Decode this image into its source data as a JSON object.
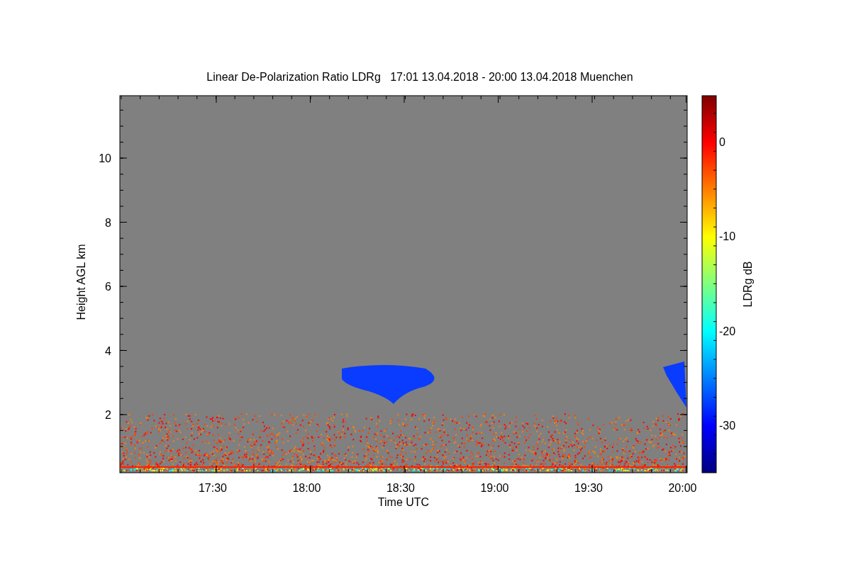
{
  "plot": {
    "title": "Linear De-Polarization Ratio LDRg   17:01 13.04.2018 - 20:00 13.04.2018 Muenchen",
    "x_axis": {
      "label": "Time UTC",
      "ticks": [
        "17:30",
        "18:00",
        "18:30",
        "19:00",
        "19:30",
        "20:00"
      ]
    },
    "y_axis": {
      "label": "Height AGL km",
      "ticks": [
        "10",
        "8",
        "6",
        "4",
        "2"
      ]
    },
    "colorbar": {
      "label": "LDRg dB",
      "ticks": [
        "0",
        "-10",
        "-20",
        "-30"
      ]
    }
  }
}
